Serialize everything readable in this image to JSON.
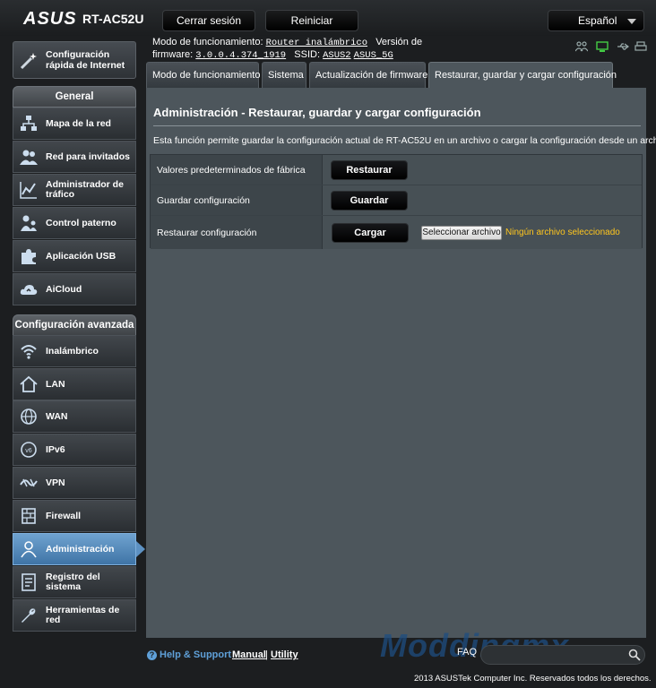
{
  "header": {
    "logo": "ASUS",
    "model": "RT-AC52U",
    "logout_label": "Cerrar sesión",
    "reboot_label": "Reiniciar",
    "language": "Español"
  },
  "info": {
    "mode_label": "Modo de funcionamiento:",
    "mode_value": "Router inalámbrico",
    "firmware_label_1": "Versión de",
    "firmware_label_2": "firmware:",
    "firmware_value": "3.0.0.4.374_1919",
    "ssid_label": "SSID:",
    "ssid_1": "ASUS2",
    "ssid_2": "ASUS_5G"
  },
  "quick_setup": {
    "label": "Configuración rápida de Internet"
  },
  "sidebar": {
    "general_header": "General",
    "general_items": [
      {
        "label": "Mapa de la red",
        "icon": "network-map-icon"
      },
      {
        "label": "Red para invitados",
        "icon": "guest-network-icon"
      },
      {
        "label": "Administrador de tráfico",
        "icon": "traffic-manager-icon"
      },
      {
        "label": "Control paterno",
        "icon": "parental-control-icon"
      },
      {
        "label": "Aplicación USB",
        "icon": "usb-app-icon"
      },
      {
        "label": "AiCloud",
        "icon": "aicloud-icon"
      }
    ],
    "advanced_header": "Configuración avanzada",
    "advanced_items": [
      {
        "label": "Inalámbrico",
        "icon": "wireless-icon"
      },
      {
        "label": "LAN",
        "icon": "lan-icon"
      },
      {
        "label": "WAN",
        "icon": "wan-icon"
      },
      {
        "label": "IPv6",
        "icon": "ipv6-icon"
      },
      {
        "label": "VPN",
        "icon": "vpn-icon"
      },
      {
        "label": "Firewall",
        "icon": "firewall-icon"
      },
      {
        "label": "Administración",
        "icon": "administration-icon",
        "active": true
      },
      {
        "label": "Registro del sistema",
        "icon": "system-log-icon"
      },
      {
        "label": "Herramientas de red",
        "icon": "network-tools-icon"
      }
    ]
  },
  "tabs": [
    {
      "label": "Modo de funcionamiento"
    },
    {
      "label": "Sistema"
    },
    {
      "label": "Actualización de firmware"
    },
    {
      "label": "Restaurar, guardar y cargar configuración",
      "active": true
    }
  ],
  "main": {
    "title": "Administración - Restaurar, guardar y cargar configuración",
    "description": "Esta función permite guardar la configuración actual de RT-AC52U en un archivo o cargar la configuración desde un archivo.",
    "rows": [
      {
        "label": "Valores predeterminados de fábrica",
        "button": "Restaurar"
      },
      {
        "label": "Guardar configuración",
        "button": "Guardar"
      },
      {
        "label": "Restaurar configuración",
        "button": "Cargar"
      }
    ],
    "file_button": "Seleccionar archivo",
    "file_status": "Ningún archivo seleccionado"
  },
  "footer": {
    "help": "Help & Support",
    "manual": "Manual",
    "separator": "|",
    "utility": "Utility",
    "faq": "FAQ",
    "watermark": "Moddingmx",
    "copyright": "2013 ASUSTek Computer Inc. Reservados todos los derechos."
  },
  "colors": {
    "panel": "#4d565c",
    "active_menu": "#5d91c2",
    "file_status": "#ffc61e",
    "link": "#5fa0d8"
  }
}
